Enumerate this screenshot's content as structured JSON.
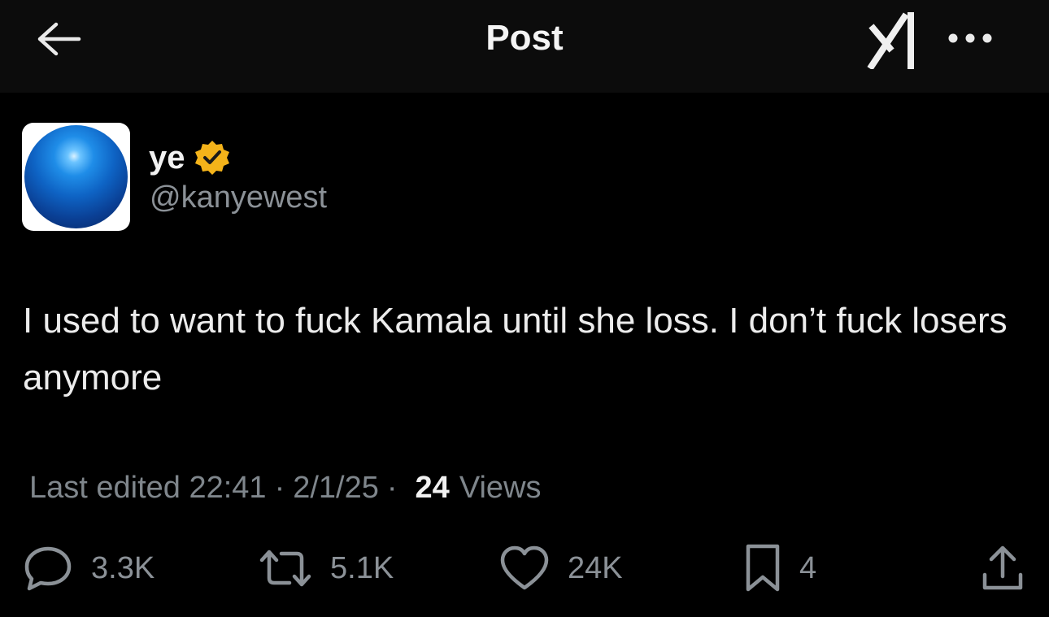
{
  "header": {
    "title": "Post",
    "icons": {
      "back": "arrow-left-icon",
      "grok": "grok-icon",
      "more": "more-horizontal-icon"
    }
  },
  "author": {
    "display_name": "ye",
    "handle": "@kanyewest",
    "verified": true,
    "verified_color": "#f4b31a",
    "avatar": "blue-orb-avatar"
  },
  "post": {
    "text": "I used to want to fuck Kamala until she loss. I don’t fuck losers anymore"
  },
  "meta": {
    "edited": "Last edited 22:41",
    "date": "2/1/25",
    "separator": "·",
    "views_count": "24",
    "views_label": "Views"
  },
  "actions": {
    "replies": "3.3K",
    "reposts": "5.1K",
    "likes": "24K",
    "bookmarks": "4",
    "icons": [
      "reply-icon",
      "repost-icon",
      "like-icon",
      "bookmark-icon",
      "share-icon"
    ]
  },
  "colors": {
    "background": "#000000",
    "header_background": "#0c0c0c",
    "text_primary": "#ececec",
    "text_secondary": "#8b9197"
  }
}
